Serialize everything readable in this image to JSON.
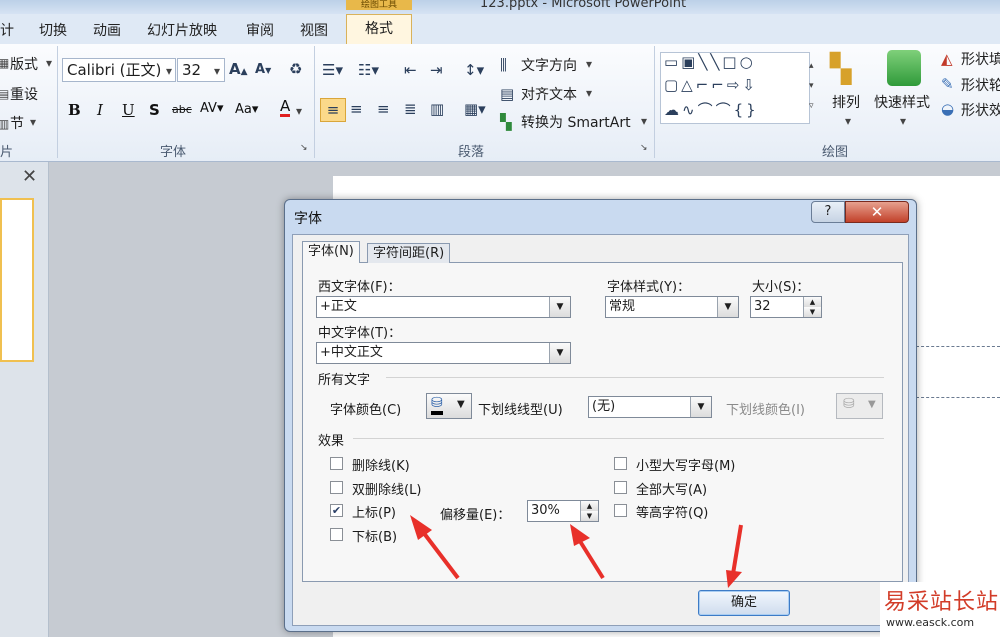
{
  "window": {
    "title": "123.pptx - Microsoft PowerPoint",
    "context_tool": "绘图工具"
  },
  "tabs": {
    "design": "计",
    "transitions": "切换",
    "animations": "动画",
    "slideshow": "幻灯片放映",
    "review": "审阅",
    "view": "视图",
    "format": "格式"
  },
  "ribbon": {
    "slides": {
      "layout": "版式",
      "reset": "重设",
      "section": "节",
      "label": "片"
    },
    "font": {
      "family": "Calibri (正文)",
      "size": "32",
      "label": "字体"
    },
    "paragraph": {
      "text_direction": "文字方向",
      "align_text": "对齐文本",
      "smartart": "转换为 SmartArt",
      "label": "段落"
    },
    "drawing": {
      "arrange": "排列",
      "quick_styles": "快速样式",
      "shape_fill": "形状填",
      "shape_outline": "形状轮",
      "shape_effects": "形状效",
      "label": "绘图"
    }
  },
  "dialog": {
    "title": "字体",
    "help": "?",
    "close": "✕",
    "tabs": {
      "font": "字体(N)",
      "spacing": "字符间距(R)"
    },
    "latin_font": {
      "label": "西文字体(F)：",
      "value": "+正文"
    },
    "font_style": {
      "label": "字体样式(Y)：",
      "value": "常规"
    },
    "size": {
      "label": "大小(S)：",
      "value": "32"
    },
    "asian_font": {
      "label": "中文字体(T)：",
      "value": "+中文正文"
    },
    "all_text": {
      "heading": "所有文字",
      "font_color_label": "字体颜色(C)",
      "underline_style_label": "下划线线型(U)",
      "underline_style_value": "(无)",
      "underline_color_label": "下划线颜色(I)"
    },
    "effects": {
      "heading": "效果",
      "strikethrough": {
        "label": "删除线(K)",
        "checked": false
      },
      "double_strikethrough": {
        "label": "双删除线(L)",
        "checked": false
      },
      "superscript": {
        "label": "上标(P)",
        "checked": true
      },
      "subscript": {
        "label": "下标(B)",
        "checked": false
      },
      "offset_label": "偏移量(E)：",
      "offset_value": "30%",
      "small_caps": {
        "label": "小型大写字母(M)",
        "checked": false
      },
      "all_caps": {
        "label": "全部大写(A)",
        "checked": false
      },
      "equalize_height": {
        "label": "等高字符(Q)",
        "checked": false
      }
    },
    "ok": "确定"
  },
  "watermark": {
    "cn": "易采站长站",
    "url": "www.easck.com"
  },
  "colors": {
    "annotation_arrow": "#e8302a",
    "close_button": "#c2412a",
    "ribbon_highlight": "#fbd98a"
  }
}
